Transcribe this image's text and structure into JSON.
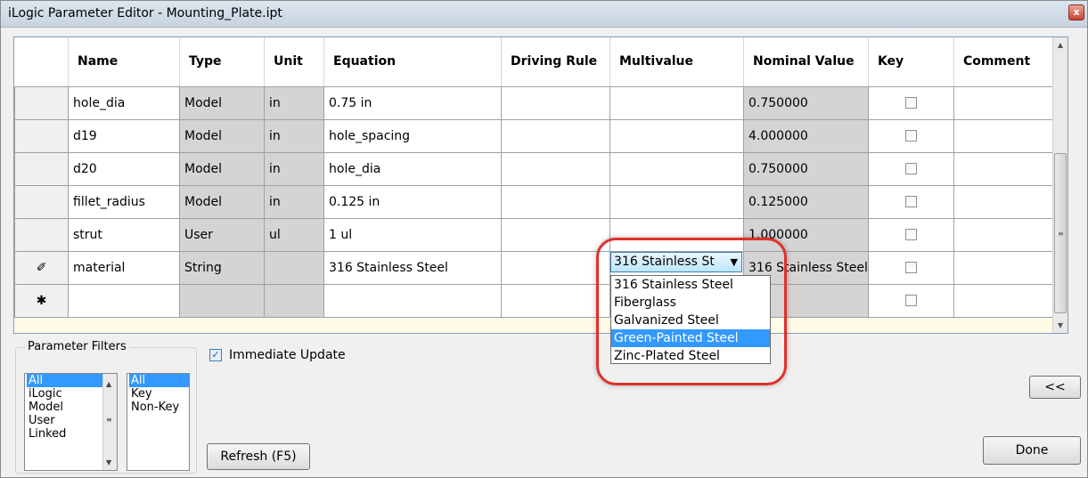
{
  "window": {
    "title": "iLogic Parameter Editor - Mounting_Plate.ipt",
    "close_glyph": "x"
  },
  "grid": {
    "columns": [
      "Name",
      "Type",
      "Unit",
      "Equation",
      "Driving Rule",
      "Multivalue",
      "Nominal Value",
      "Key",
      "Comment"
    ],
    "rows": [
      {
        "marker": "",
        "name": "hole_dia",
        "type": "Model",
        "unit": "in",
        "equation": "0.75 in",
        "driving_rule": "",
        "multivalue": "",
        "nominal": "0.750000",
        "comment": ""
      },
      {
        "marker": "",
        "name": "d19",
        "type": "Model",
        "unit": "in",
        "equation": "hole_spacing",
        "driving_rule": "",
        "multivalue": "",
        "nominal": "4.000000",
        "comment": ""
      },
      {
        "marker": "",
        "name": "d20",
        "type": "Model",
        "unit": "in",
        "equation": "hole_dia",
        "driving_rule": "",
        "multivalue": "",
        "nominal": "0.750000",
        "comment": ""
      },
      {
        "marker": "",
        "name": "fillet_radius",
        "type": "Model",
        "unit": "in",
        "equation": "0.125 in",
        "driving_rule": "",
        "multivalue": "",
        "nominal": "0.125000",
        "comment": ""
      },
      {
        "marker": "",
        "name": "strut",
        "type": "User",
        "unit": "ul",
        "equation": "1 ul",
        "driving_rule": "",
        "multivalue": "",
        "nominal": "1.000000",
        "comment": ""
      },
      {
        "marker": "✐",
        "name": "material",
        "type": "String",
        "unit": "",
        "equation": "316 Stainless Steel",
        "driving_rule": "",
        "multivalue": "",
        "nominal": "316 Stainless Steel",
        "comment": ""
      },
      {
        "marker": "✱",
        "name": "",
        "type": "",
        "unit": "",
        "equation": "",
        "driving_rule": "",
        "multivalue": "",
        "nominal": "",
        "comment": ""
      }
    ]
  },
  "multivalue_dropdown": {
    "selected": "316 Stainless St",
    "arrow": "▼",
    "options": [
      "316 Stainless Steel",
      "Fiberglass",
      "Galvanized Steel",
      "Green-Painted Steel",
      "Zinc-Plated Steel"
    ],
    "highlighted": "Green-Painted Steel"
  },
  "filters": {
    "legend": "Parameter Filters",
    "list1": [
      "All",
      "iLogic",
      "Model",
      "User",
      "Linked"
    ],
    "list1_selected": "All",
    "list2": [
      "All",
      "Key",
      "Non-Key"
    ],
    "list2_selected": "All"
  },
  "immediate_update": {
    "label": "Immediate Update",
    "checked": true,
    "check_glyph": "✓"
  },
  "buttons": {
    "refresh": "Refresh (F5)",
    "collapse": "<<",
    "done": "Done"
  }
}
